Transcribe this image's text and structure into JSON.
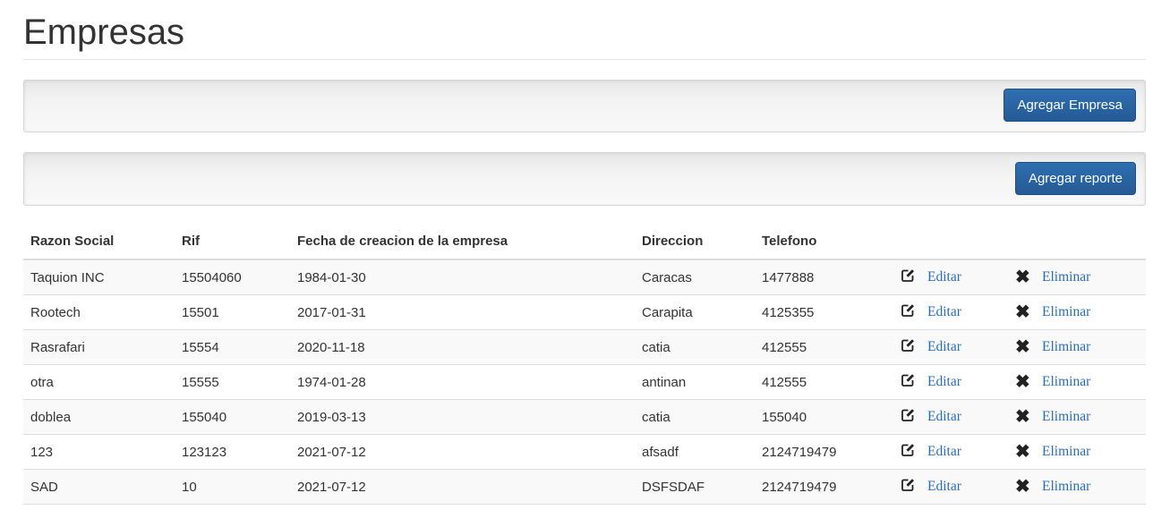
{
  "page": {
    "title": "Empresas"
  },
  "toolbar1": {
    "button_label": "Agregar Empresa"
  },
  "toolbar2": {
    "button_label": "Agregar reporte"
  },
  "table": {
    "headers": [
      "Razon Social",
      "Rif",
      "Fecha de creacion de la empresa",
      "Direccion",
      "Telefono"
    ],
    "edit_label": "Editar",
    "delete_label": "Eliminar",
    "rows": [
      [
        "Taquion INC",
        "15504060",
        "1984-01-30",
        "Caracas",
        "1477888"
      ],
      [
        "Rootech",
        "15501",
        "2017-01-31",
        "Carapita",
        "4125355"
      ],
      [
        "Rasrafari",
        "15554",
        "2020-11-18",
        "catia",
        "412555"
      ],
      [
        "otra",
        "15555",
        "1974-01-28",
        "antinan",
        "412555"
      ],
      [
        "doblea",
        "155040",
        "2019-03-13",
        "catia",
        "155040"
      ],
      [
        "123",
        "123123",
        "2021-07-12",
        "afsadf",
        "2124719479"
      ],
      [
        "SAD",
        "10",
        "2021-07-12",
        "DSFSDAF",
        "2124719479"
      ]
    ]
  },
  "icons": {
    "edit": "edit-square-icon",
    "delete": "close-x-icon"
  },
  "colors": {
    "button": "#2a67a6",
    "link": "#2a6db5"
  }
}
